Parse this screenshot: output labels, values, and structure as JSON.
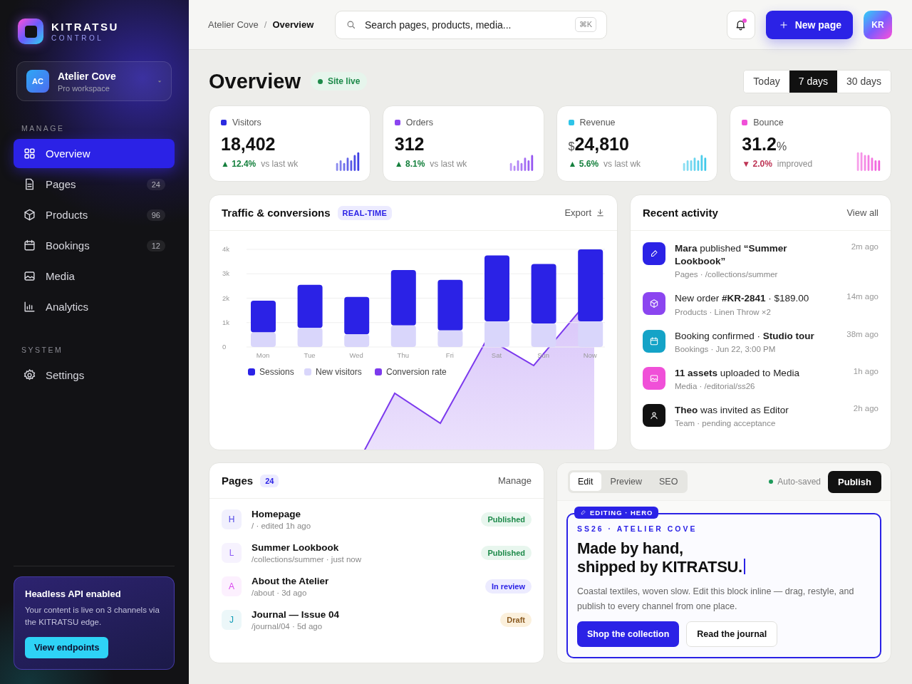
{
  "sidebar": {
    "brand": {
      "name": "KITRATSU",
      "tagline": "CONTROL"
    },
    "workspace": {
      "initials": "AC",
      "name": "Atelier Cove",
      "plan": "Pro workspace"
    },
    "sections": [
      {
        "title": "MANAGE",
        "items": [
          {
            "label": "Overview",
            "selected": true
          },
          {
            "label": "Pages",
            "count": "24",
            "selected": false
          },
          {
            "label": "Products",
            "count": "96",
            "selected": false
          },
          {
            "label": "Bookings",
            "count": "12",
            "selected": false
          },
          {
            "label": "Media",
            "selected": false
          },
          {
            "label": "Analytics",
            "selected": false
          }
        ]
      },
      {
        "title": "SYSTEM",
        "items": [
          {
            "label": "Settings",
            "selected": false
          }
        ]
      }
    ],
    "promo": {
      "title": "Headless API enabled",
      "text": "Your content is live on 3 channels via the KITRATSU edge.",
      "button": "View endpoints"
    }
  },
  "header": {
    "breadcrumb": [
      "Atelier Cove",
      "Overview"
    ],
    "separator": "/",
    "search": {
      "placeholder": "Search pages, products, media...",
      "shortcut": "⌘K"
    },
    "notifications": {
      "unread": true
    },
    "new_button": "New page",
    "avatar": "KR"
  },
  "page": {
    "title": "Overview",
    "status": "Site live",
    "ranges": [
      {
        "label": "Today",
        "selected": false
      },
      {
        "label": "7 days",
        "selected": true
      },
      {
        "label": "30 days",
        "selected": false
      }
    ]
  },
  "kpis": [
    {
      "label": "Visitors",
      "color": "#2b2be0",
      "value": "18,402",
      "negative": false,
      "delta": "▲ 12.4%",
      "note": "vs last wk"
    },
    {
      "label": "Orders",
      "color": "#8b45f0",
      "value": "312",
      "negative": false,
      "delta": "▲ 8.1%",
      "note": "vs last wk"
    },
    {
      "label": "Revenue",
      "color": "#2ec4e8",
      "prefix": "$",
      "value": "24,810",
      "negative": false,
      "delta": "▲ 5.6%",
      "note": "vs last wk"
    },
    {
      "label": "Bounce",
      "color": "#f050d8",
      "value": "31.2",
      "unit": "%",
      "negative": true,
      "delta": "▼ 2.0%",
      "note": "improved"
    }
  ],
  "traffic": {
    "title": "Traffic & conversions",
    "badge": "REAL-TIME",
    "action": "Export",
    "overlay": {
      "name": "Conversion rate",
      "color": "#7c3aed"
    },
    "chart_data": {
      "type": "bar",
      "categories": [
        "Mon",
        "Tue",
        "Wed",
        "Thu",
        "Fri",
        "Sat",
        "Sun",
        "Now"
      ],
      "ylim": [
        0,
        4000
      ],
      "yticks": [
        {
          "value": 0,
          "label": "0"
        },
        {
          "value": 1000,
          "label": "1k"
        },
        {
          "value": 2000,
          "label": "2k"
        },
        {
          "value": 3000,
          "label": "3k"
        },
        {
          "value": 4000,
          "label": "4k"
        }
      ],
      "stacked": true,
      "grid": true,
      "legend": "bottom",
      "series": [
        {
          "name": "Sessions",
          "color": "#2b22e6",
          "values": [
            1300,
            1770,
            1530,
            2270,
            2070,
            2700,
            2440,
            2950
          ]
        },
        {
          "name": "New visitors",
          "color": "#d9d6fb",
          "values": [
            600,
            780,
            520,
            880,
            680,
            1050,
            960,
            1050
          ]
        }
      ]
    }
  },
  "activity": {
    "title": "Recent activity",
    "action": "View all",
    "items": [
      {
        "color": "#2b22e6",
        "text": "**Mara** published **“Summer Lookbook”**",
        "meta": "Pages · /collections/summer",
        "time": "2m ago"
      },
      {
        "color": "#8b45f0",
        "text": "New order **#KR-2841** · $189.00",
        "meta": "Products · Linen Throw ×2",
        "time": "14m ago"
      },
      {
        "color": "#14a3c7",
        "text": "Booking confirmed · **Studio tour**",
        "meta": "Bookings · Jun 22, 3:00 PM",
        "time": "38m ago"
      },
      {
        "color": "#f050d8",
        "text": "**11 assets** uploaded to Media",
        "meta": "Media · /editorial/ss26",
        "time": "1h ago"
      },
      {
        "color": "#111111",
        "text": "**Theo** was invited as Editor",
        "meta": "Team · pending acceptance",
        "time": "2h ago"
      }
    ]
  },
  "pages": {
    "title": "Pages",
    "count": "24",
    "action": "Manage",
    "rows": [
      {
        "initial": "H",
        "color": "#4f46e5",
        "title": "Homepage",
        "meta": "/ · edited 1h ago",
        "status": "Published",
        "kind": "published"
      },
      {
        "initial": "L",
        "color": "#8b5cf6",
        "title": "Summer Lookbook",
        "meta": "/collections/summer · just now",
        "status": "Published",
        "kind": "published"
      },
      {
        "initial": "A",
        "color": "#d946ef",
        "title": "About the Atelier",
        "meta": "/about · 3d ago",
        "status": "In review",
        "kind": "review"
      },
      {
        "initial": "J",
        "color": "#0e9bb5",
        "title": "Journal — Issue 04",
        "meta": "/journal/04 · 5d ago",
        "status": "Draft",
        "kind": "draft"
      }
    ]
  },
  "editor": {
    "tabs": [
      {
        "label": "Edit",
        "selected": true
      },
      {
        "label": "Preview",
        "selected": false
      },
      {
        "label": "SEO",
        "selected": false
      }
    ],
    "save_status": "Auto-saved",
    "publish": "Publish",
    "block_badge": "EDITING · HERO",
    "eyebrow": "SS26 · ATELIER COVE",
    "heading": "Made by hand,\nshipped by KITRATSU.",
    "body": "Coastal textiles, woven slow. Edit this block inline — drag, restyle, and publish to every channel from one place.",
    "primary": "Shop the collection",
    "secondary": "Read the journal"
  }
}
